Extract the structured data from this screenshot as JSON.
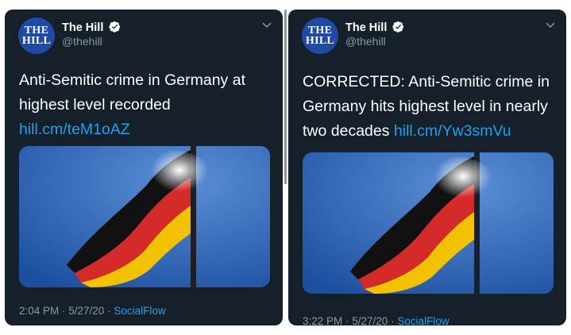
{
  "tweets": [
    {
      "avatar": {
        "line1": "THE",
        "line2": "HILL"
      },
      "name": "The Hill",
      "handle": "@thehill",
      "text": "Anti-Semitic crime in Germany at highest level recorded ",
      "link": "hill.cm/teM1oAZ",
      "time": "2:04 PM · 5/27/20 · ",
      "source": "SocialFlow"
    },
    {
      "avatar": {
        "line1": "THE",
        "line2": "HILL"
      },
      "name": "The Hill",
      "handle": "@thehill",
      "text": "CORRECTED: Anti-Semitic crime in Germany hits highest level in nearly two decades ",
      "link": "hill.cm/Yw3smVu",
      "time": "3:22 PM · 5/27/20 · ",
      "source": "SocialFlow"
    }
  ],
  "icons": {
    "verified": "verified-badge-icon",
    "chevron": "chevron-down-icon",
    "media": "german-flag-photo"
  },
  "colors": {
    "background": "#15202b",
    "primary_text": "#ffffff",
    "secondary_text": "#8899a6",
    "link": "#1da1f2",
    "avatar": "#1f4ba5"
  }
}
